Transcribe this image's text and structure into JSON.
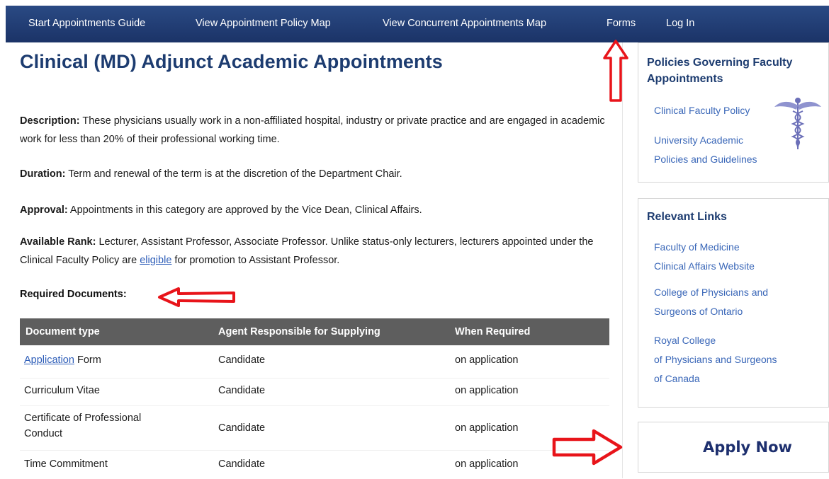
{
  "nav": {
    "items": [
      {
        "label": "Start Appointments Guide"
      },
      {
        "label": "View Appointment Policy Map"
      },
      {
        "label": "View Concurrent Appointments Map"
      },
      {
        "label": "Forms"
      },
      {
        "label": "Log In"
      }
    ]
  },
  "main": {
    "title": "Clinical (MD) Adjunct Academic Appointments",
    "description": {
      "label": "Description:",
      "text": " These physicians usually work in a non-affiliated hospital, industry or private practice and are engaged in academic work for less than 20% of their professional working time."
    },
    "duration": {
      "label": "Duration:",
      "text": " Term and renewal of the term is at the discretion of the Department Chair."
    },
    "approval": {
      "label": "Approval:",
      "text": " Appointments in this category are approved by the Vice Dean, Clinical Affairs."
    },
    "rank": {
      "label": "Available Rank:",
      "text_before": " Lecturer, Assistant Professor, Associate Professor. Unlike status-only lecturers, lecturers appointed under the Clinical Faculty Policy are ",
      "link": "eligible",
      "text_after": " for promotion to Assistant Professor."
    },
    "required_heading": "Required Documents:",
    "table": {
      "headers": [
        "Document type",
        "Agent Responsible for Supplying",
        "When Required"
      ],
      "rows": [
        {
          "doc_link": "Application",
          "doc_rest": " Form",
          "agent": "Candidate",
          "when": "on application"
        },
        {
          "doc": "Curriculum Vitae",
          "agent": "Candidate",
          "when": "on application"
        },
        {
          "doc_line1": "Certificate of Professional",
          "doc_line2": "Conduct",
          "agent": "Candidate",
          "when": "on application"
        },
        {
          "doc": "Time Commitment",
          "agent": "Candidate",
          "when": "on application"
        }
      ]
    }
  },
  "sidebar": {
    "policies": {
      "heading_line1": "Policies Governing Faculty",
      "heading_line2": "Appointments",
      "links": [
        {
          "line1": "Clinical Faculty Policy"
        },
        {
          "line1": "University Academic",
          "line2": "Policies and Guidelines"
        }
      ],
      "icon": "caduceus-icon"
    },
    "relevant": {
      "heading": "Relevant Links",
      "links": [
        {
          "line1": "Faculty of Medicine",
          "line2": "Clinical Affairs Website"
        },
        {
          "line1": "College of Physicians and",
          "line2": "Surgeons of Ontario"
        },
        {
          "line1": "Royal College",
          "line2": "of Physicians and Surgeons",
          "line3": "of Canada"
        }
      ]
    },
    "apply_label": "Apply Now"
  },
  "colors": {
    "nav_bg": "#1f3a70",
    "title": "#1d3c70",
    "link": "#2d5db8",
    "table_header": "#5e5e5e",
    "annotation_arrow": "#e8141a"
  }
}
